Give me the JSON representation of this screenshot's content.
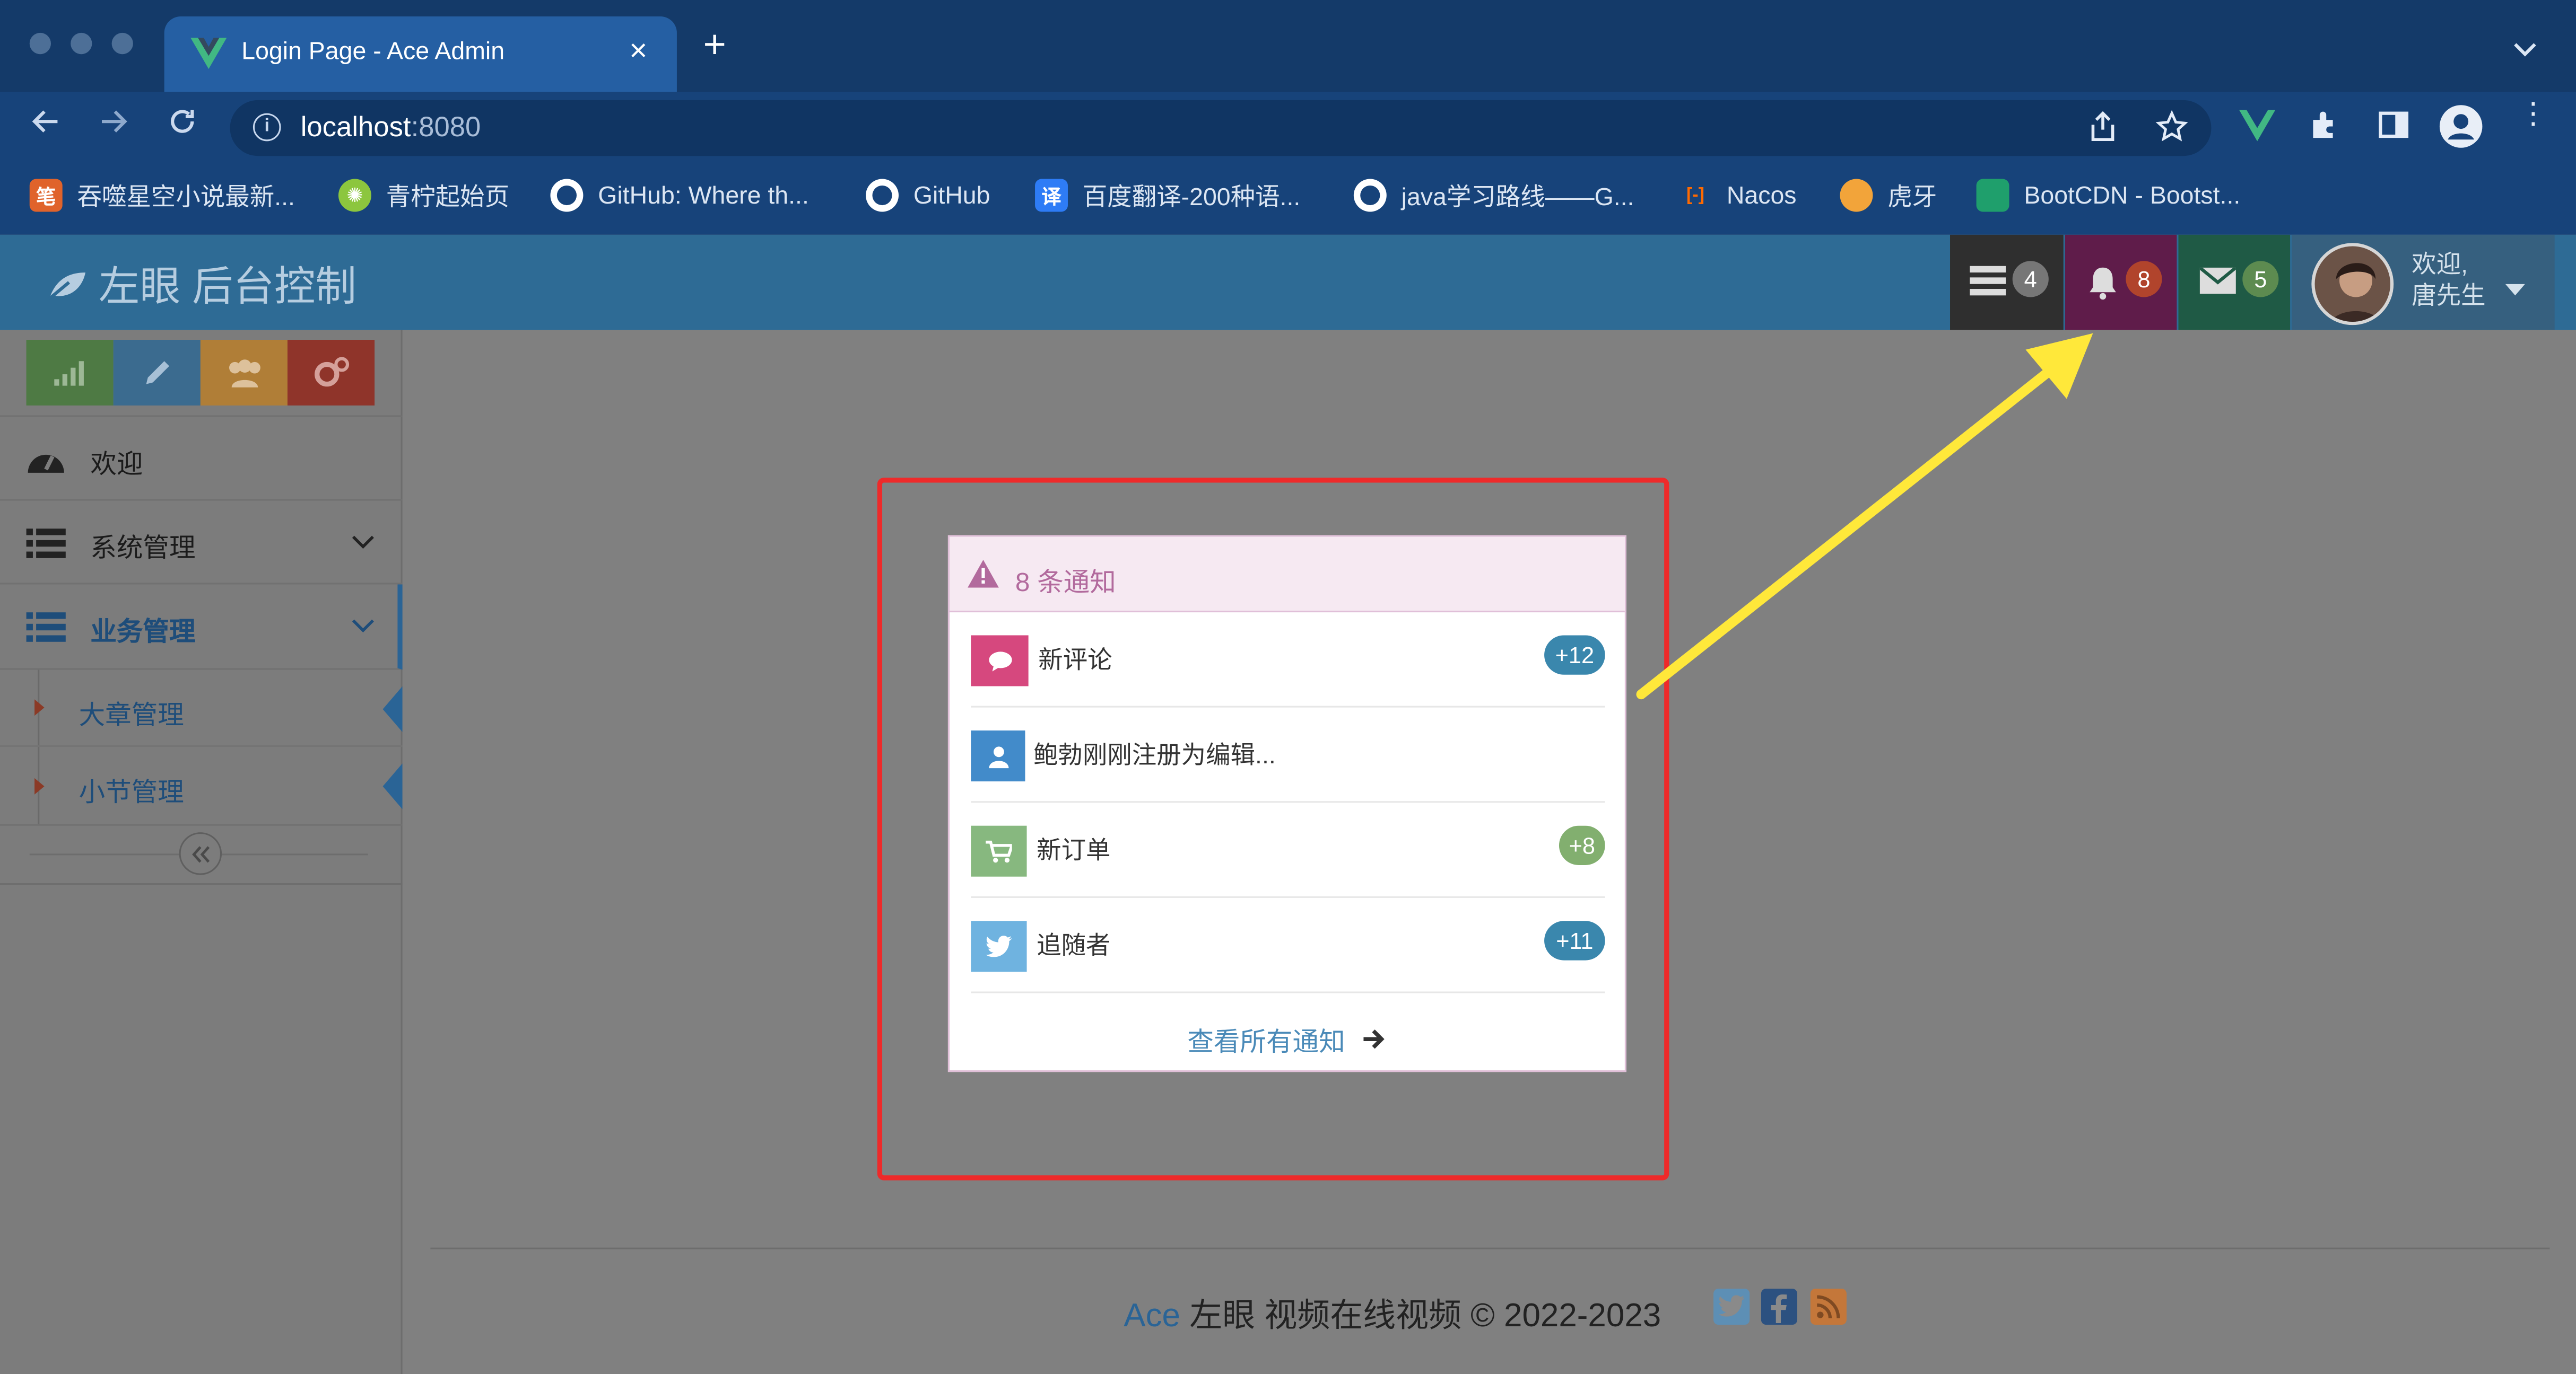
{
  "browser": {
    "tab_title": "Login Page - Ace Admin",
    "url_host": "localhost",
    "url_port": ":8080",
    "bookmarks": [
      {
        "icon": "笔",
        "label": "吞噬星空小说最新..."
      },
      {
        "icon": "✺",
        "label": "青柠起始页"
      },
      {
        "icon": "",
        "label": "GitHub: Where th..."
      },
      {
        "icon": "",
        "label": "GitHub"
      },
      {
        "icon": "译",
        "label": "百度翻译-200种语..."
      },
      {
        "icon": "",
        "label": "java学习路线——G..."
      },
      {
        "icon": "[-]",
        "label": "Nacos"
      },
      {
        "icon": "",
        "label": "虎牙"
      },
      {
        "icon": "",
        "label": "BootCDN - Bootst..."
      }
    ]
  },
  "navbar": {
    "brand": "左眼 后台控制",
    "tasks_count": "4",
    "notifications_count": "8",
    "messages_count": "5",
    "user_greeting": "欢迎,",
    "user_name": "唐先生"
  },
  "sidebar": {
    "items": [
      {
        "label": "欢迎"
      },
      {
        "label": "系统管理"
      },
      {
        "label": "业务管理"
      }
    ],
    "subitems": [
      {
        "label": "大章管理"
      },
      {
        "label": "小节管理"
      }
    ]
  },
  "notifications": {
    "header": "8 条通知",
    "items": [
      {
        "label": "新评论",
        "badge": "+12",
        "color": "#d6487e"
      },
      {
        "label": "鲍勃刚刚注册为编辑...",
        "badge": "",
        "color": "#428bca"
      },
      {
        "label": "新订单",
        "badge": "+8",
        "color": "#87b87f"
      },
      {
        "label": "追随者",
        "badge": "+11",
        "color": "#6fb3e0"
      }
    ],
    "footer_link": "查看所有通知"
  },
  "footer": {
    "brand": "Ace",
    "text": "左眼 视频在线视频 © 2022-2023"
  },
  "colors": {
    "navbar": "#2e6b95",
    "tasks_btn": "#2f2f2f",
    "notif_btn": "#5f1c4a",
    "msg_btn": "#1f5a45",
    "annotation_box": "#ee2a2a",
    "annotation_arrow": "#ffe83a"
  }
}
